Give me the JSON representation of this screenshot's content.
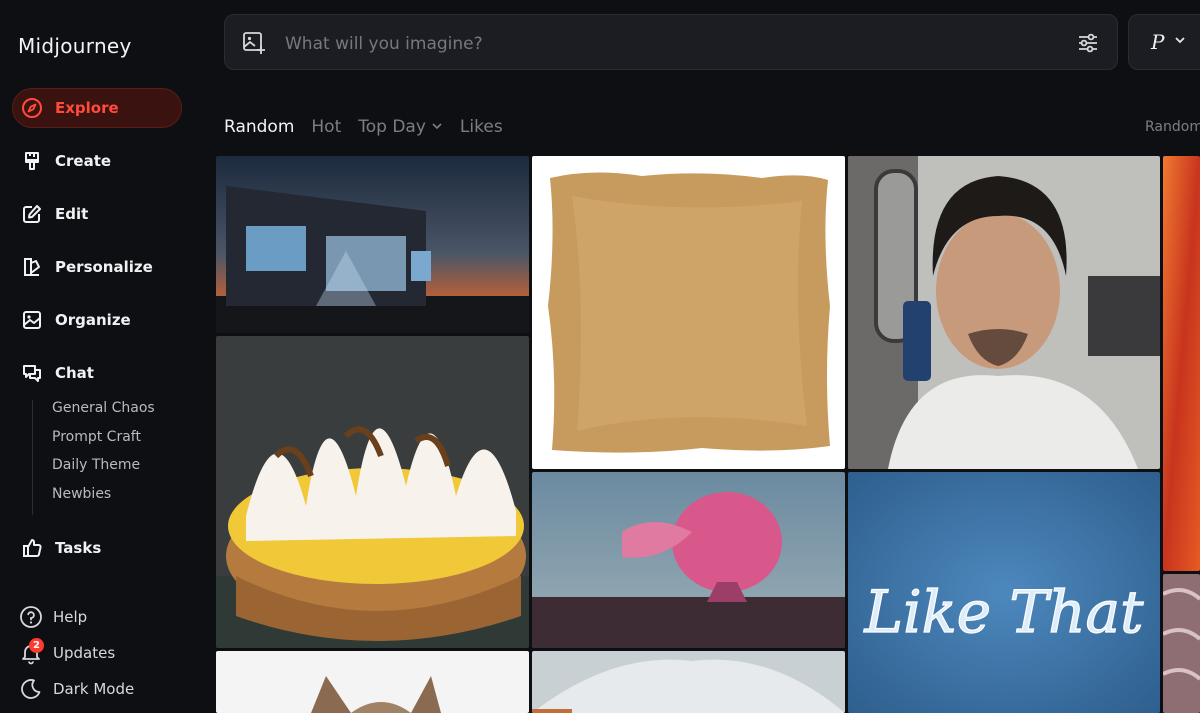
{
  "app": {
    "title": "Midjourney"
  },
  "nav": {
    "explore": "Explore",
    "create": "Create",
    "edit": "Edit",
    "personalize": "Personalize",
    "organize": "Organize",
    "chat": "Chat",
    "tasks": "Tasks"
  },
  "chat_channels": [
    "General Chaos",
    "Prompt Craft",
    "Daily Theme",
    "Newbies"
  ],
  "bottom": {
    "help": "Help",
    "updates": "Updates",
    "updates_badge": "2",
    "dark_mode": "Dark Mode"
  },
  "search": {
    "placeholder": "What will you imagine?"
  },
  "profile": {
    "initial": "P"
  },
  "tabs": {
    "random": "Random",
    "hot": "Hot",
    "top_day": "Top Day",
    "likes": "Likes"
  },
  "sort_label": "Random",
  "gallery": {
    "like_that_text": "Like That"
  },
  "colors": {
    "accent": "#ff4a3d",
    "background": "#0e0f13",
    "panel": "#1c1d22"
  }
}
